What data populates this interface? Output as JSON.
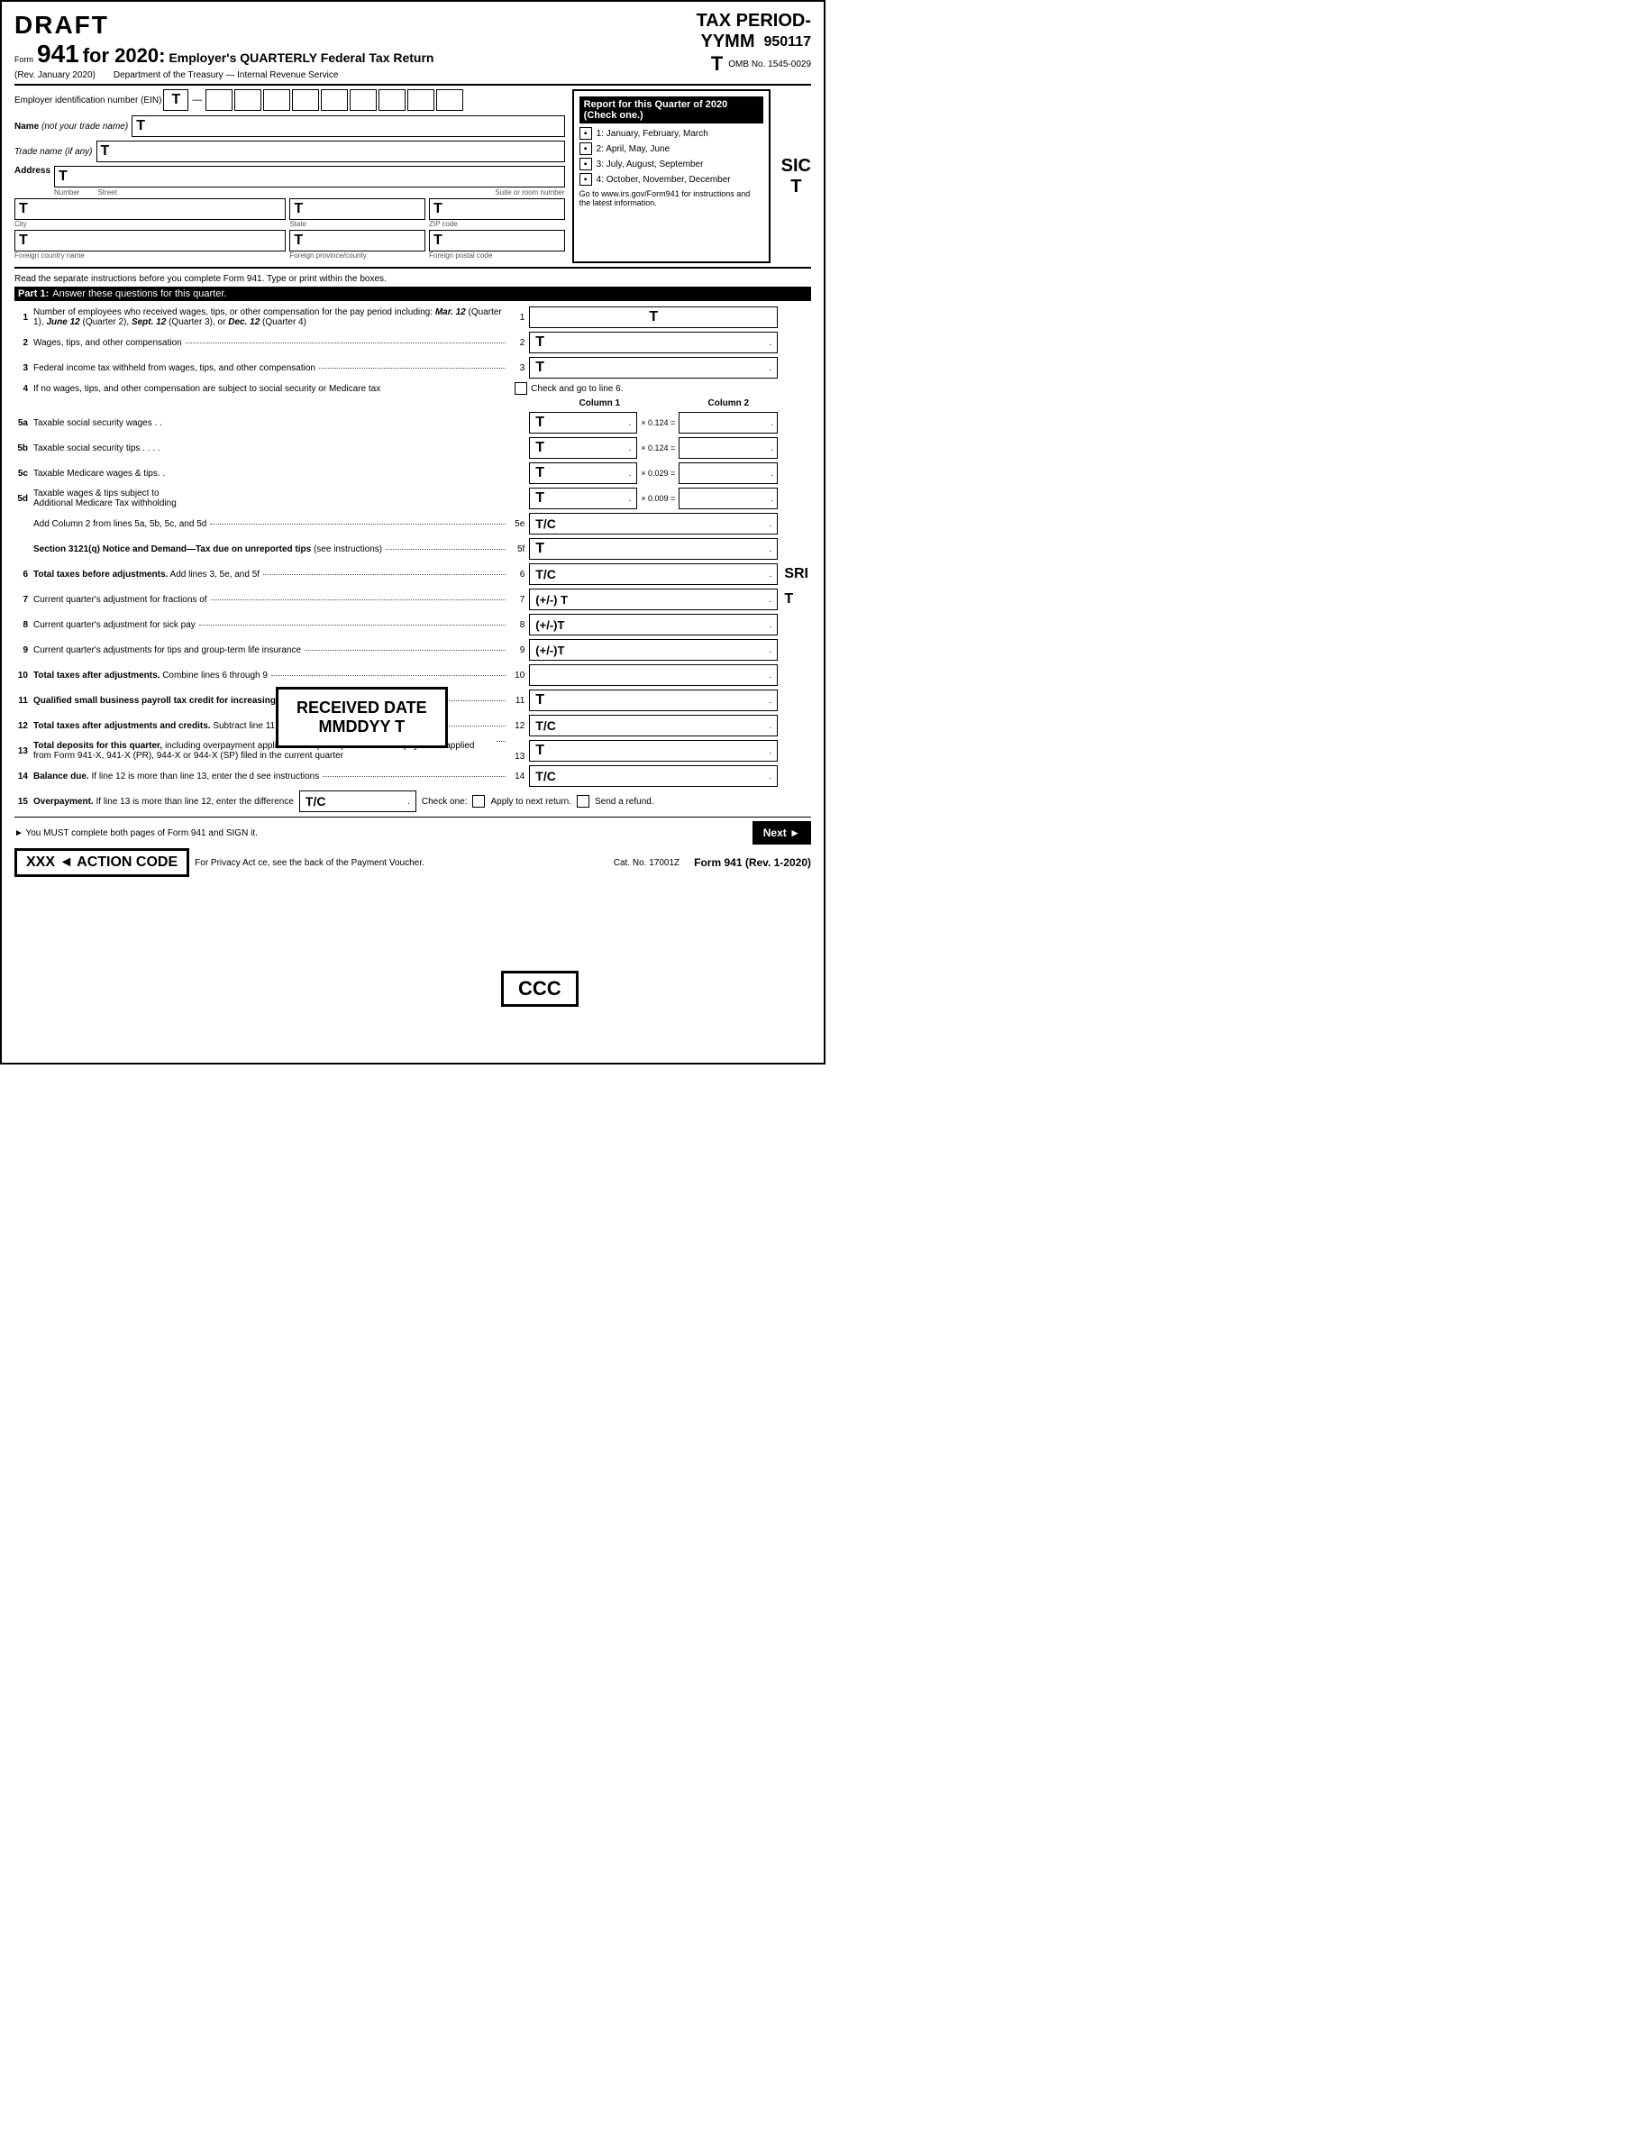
{
  "header": {
    "draft_label": "DRAFT",
    "tax_period_title": "TAX PERIOD-",
    "tax_period_yymm": "YYMM",
    "tax_period_code": "950117",
    "tax_period_T": "T",
    "form_label": "Form",
    "form_number": "941",
    "form_year": "for 2020:",
    "form_subtitle": "Employer's QUARTERLY Federal Tax Return",
    "rev_date": "(Rev. January 2020)",
    "department": "Department of the Treasury — Internal Revenue Service",
    "omb_label": "OMB No. 1545-0029"
  },
  "quarter_box": {
    "title": "Report for this Quarter of 2020",
    "subtitle": "(Check one.)",
    "q1_label": "1: January, February, March",
    "q2_label": "2: April, May, June",
    "q3_label": "3: July, August, September",
    "q4_label": "4: October, November, December",
    "website_text": "Go to www.irs.gov/Form941 for instructions and the latest information."
  },
  "fields": {
    "ein_label": "Employer identification number (EIN)",
    "ein_T": "T",
    "name_label": "Name (not your trade name)",
    "name_T": "T",
    "trade_label": "Trade name (if any)",
    "trade_T": "T",
    "address_label": "Address",
    "address_T": "T",
    "number_sub": "Number",
    "street_sub": "Street",
    "suite_sub": "Suite or room number",
    "city_T": "T",
    "state_T": "T",
    "zip_T": "T",
    "city_sub": "City",
    "state_sub": "State",
    "zip_sub": "ZIP code",
    "foreign_country_T": "T",
    "foreign_province_T": "T",
    "foreign_postal_T": "T",
    "foreign_country_sub": "Foreign country name",
    "foreign_province_sub": "Foreign province/county",
    "foreign_postal_sub": "Foreign postal code"
  },
  "instructions": {
    "read_text": "Read the separate instructions before you complete Form 941. Type or print within the boxes."
  },
  "part1": {
    "header": "Part 1:",
    "instruction": "Answer these questions for this quarter.",
    "line1_text": "Number of employees who received wages, tips, or other compensation for the pay period including:",
    "line1_dates": "Mar. 12 (Quarter 1), June 12 (Quarter 2), Sept. 12 (Quarter 3), or Dec. 12 (Quarter 4)",
    "line1_num": "1",
    "line1_T": "T",
    "line2_text": "Wages, tips, and other compensation",
    "line2_num": "2",
    "line2_T": "T",
    "line3_text": "Federal income tax withheld from wages, tips, and other compensation",
    "line3_num": "3",
    "line3_T": "T",
    "line4_text": "If no wages, tips, and other compensation are subject to social security or Medicare tax",
    "line4_check": "Check and go to line 6.",
    "col1_header": "Column 1",
    "col2_header": "Column 2",
    "line5a_text": "Taxable social security wages . .",
    "line5a_T": "T",
    "line5a_mult": "× 0.124 =",
    "line5b_text": "Taxable social security tips . . . .",
    "line5b_T": "T",
    "line5b_mult": "× 0.124 =",
    "line5c_text": "Taxable Medicare wages & tips. .",
    "line5c_T": "T",
    "line5c_mult": "× 0.029 =",
    "line5d_text": "Taxable wages & tips subject to Additional Medicare Tax withholding",
    "line5d_T": "T",
    "line5d_mult": "× 0.009 =",
    "line5e_text": "Add Column 2 from lines 5a, 5b, 5c, and 5d",
    "line5e_num": "5e",
    "line5e_TC": "T/C",
    "line5f_text": "Section 3121(q) Notice and Demand—Tax due on unreported tips (see instructions)",
    "line5f_num": "5f",
    "line5f_T": "T",
    "line6_text": "Total taxes before adjustments. Add lines 3, 5e, and 5f",
    "line6_num": "6",
    "line6_TC": "T/C",
    "line7_text": "Current quarter's adjustment for fractions of",
    "line7_num": "7",
    "line7_val": "(+/-) T",
    "line8_text": "Current quarter's adjustment for sick pay",
    "line8_num": "8",
    "line8_val": "(+/-)T",
    "line9_text": "Current quarter's adjustments for tips and group-term life insurance",
    "line9_num": "9",
    "line9_val": "(+/-)T",
    "line10_text": "Total taxes after adjustments. Combine lines 6 through 9",
    "line10_num": "10",
    "line11_text": "Qualified small business payroll tax credit for increasing research activities. Attach Form 8974",
    "line11_num": "11",
    "line11_T": "T",
    "line12_text": "Total taxes after adjustments and credits. Subtract line 11 from line 10",
    "line12_num": "12",
    "line12_TC": "T/C",
    "line13_text": "Total deposits for this quarter, including overpayment applied from a prior quarter and overpayments applied from Form 941-X, 941-X (PR), 944-X or 944-X (SP) filed in the current quarter",
    "line13_num": "13",
    "line13_T": "T",
    "line14_text": "Balance due. If line 12 is more than line 13, enter the",
    "line14_text2": "d see instructions",
    "line14_num": "14",
    "line14_TC": "T/C",
    "line15_text": "Overpayment. If line 13 is more than line 12, enter the difference",
    "line15_TC": "T/C",
    "line15_check_label1": "Apply to next return.",
    "line15_check_label2": "Send a refund."
  },
  "overlays": {
    "received_date_title": "RECEIVED DATE",
    "received_date_sub": "MMDDYY    T",
    "ccc_label": "CCC",
    "action_code_label": "ACTION CODE",
    "action_xxx": "XXX ◄"
  },
  "footer": {
    "sign_text": "► You MUST complete both pages of Form 941 and SIGN it.",
    "privacy_text": "For Privacy Act",
    "payment_text": "ce, see the back of the Payment Voucher.",
    "cat_label": "Cat. No. 17001Z",
    "form_label": "Form",
    "form_number": "941",
    "rev_label": "(Rev. 1-2020)",
    "next_label": "Next ►",
    "sic_label": "SIC",
    "sic_T": "T",
    "sri_label": "SRI",
    "sri_T": "T"
  }
}
